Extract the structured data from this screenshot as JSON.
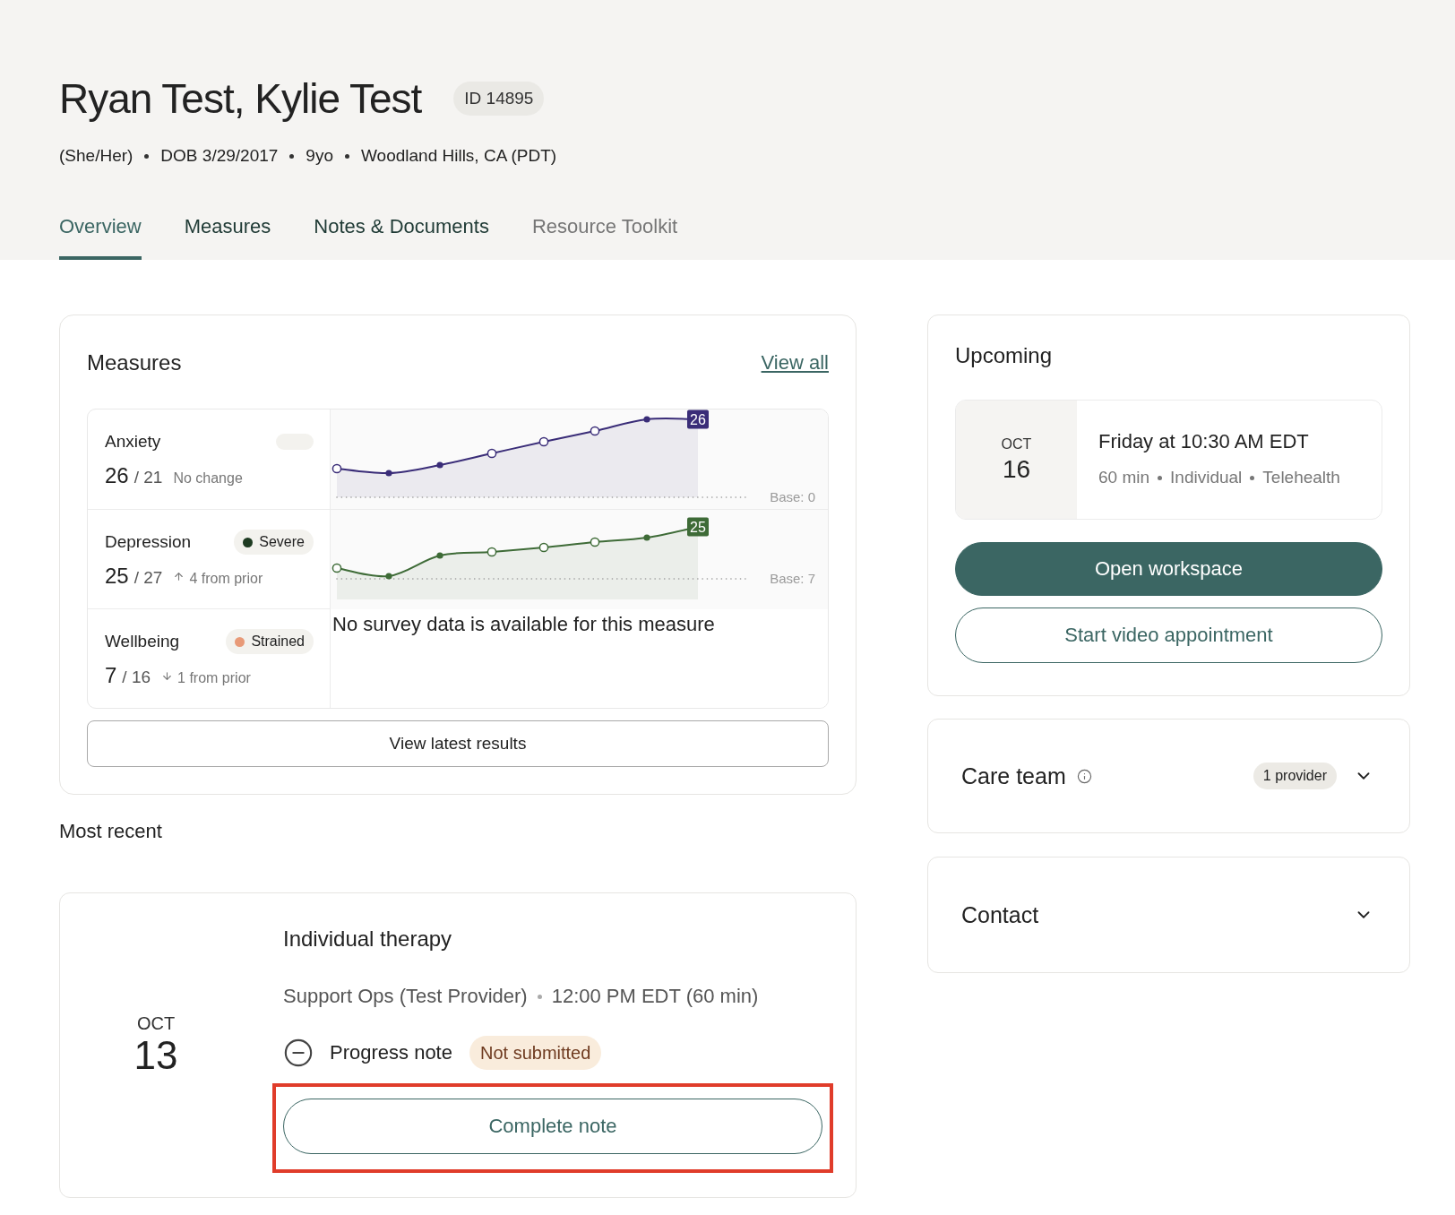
{
  "patient": {
    "name": "Ryan Test, Kylie Test",
    "id_badge": "ID 14895",
    "details": [
      "(She/Her)",
      "DOB 3/29/2017",
      "9yo",
      "Woodland Hills, CA (PDT)"
    ]
  },
  "tabs": [
    {
      "label": "Overview",
      "selected": true,
      "disabled": false
    },
    {
      "label": "Measures",
      "selected": false,
      "disabled": false
    },
    {
      "label": "Notes & Documents",
      "selected": false,
      "disabled": false
    },
    {
      "label": "Resource Toolkit",
      "selected": false,
      "disabled": true
    }
  ],
  "measures": {
    "title": "Measures",
    "link": "View all",
    "rows": [
      {
        "name": "Anxiety",
        "badge": {
          "kind": "blank"
        },
        "score": "26",
        "total": "/ 21",
        "change": {
          "kind": "none",
          "text": "No change"
        },
        "kind": "chart",
        "color": "#3a2d78",
        "end_value": "26",
        "base": "Base: 0"
      },
      {
        "name": "Depression",
        "badge": {
          "kind": "status",
          "label": "Severe",
          "color": "#1e3b22"
        },
        "score": "25",
        "total": "/ 27",
        "change": {
          "kind": "up",
          "text": "4 from prior"
        },
        "kind": "chart",
        "color": "#3e6b37",
        "end_value": "25",
        "base": "Base: 7"
      },
      {
        "name": "Wellbeing",
        "badge": {
          "kind": "status",
          "label": "Strained",
          "color": "#e89a78"
        },
        "score": "7",
        "total": "/ 16",
        "change": {
          "kind": "down",
          "text": "1 from prior"
        },
        "kind": "empty",
        "message": "No survey data is available for this measure"
      }
    ],
    "button": "View latest results"
  },
  "most_recent": {
    "heading": "Most recent",
    "month": "OCT",
    "day": "13",
    "title": "Individual therapy",
    "details": [
      "Support Ops (Test Provider)",
      "12:00 PM EDT (60 min)"
    ],
    "note": {
      "label": "Progress note",
      "status": "Not submitted"
    },
    "action": {
      "label": "Complete note",
      "highlighted": true
    }
  },
  "upcoming": {
    "title": "Upcoming",
    "month": "OCT",
    "day": "16",
    "time": "Friday at 10:30 AM EDT",
    "details": [
      "60 min",
      "Individual",
      "Telehealth"
    ],
    "buttons": [
      {
        "label": "Open workspace",
        "kind": "primary"
      },
      {
        "label": "Start video appointment",
        "kind": "secondary"
      }
    ]
  },
  "panels": [
    {
      "title": "Care team",
      "info": true,
      "badge": "1 provider",
      "expanded": false
    },
    {
      "title": "Contact",
      "info": false,
      "expanded": false
    }
  ]
}
